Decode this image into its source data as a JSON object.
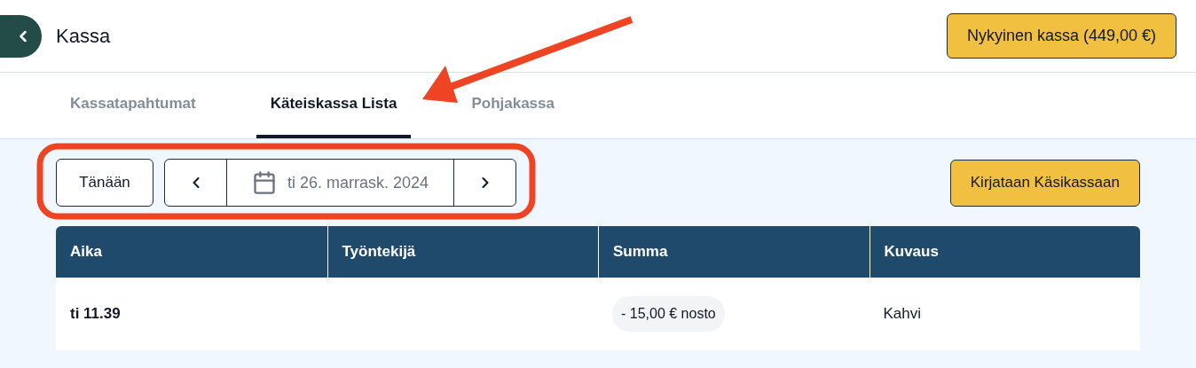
{
  "header": {
    "title": "Kassa",
    "cash_button": "Nykyinen kassa (449,00 €)"
  },
  "tabs": [
    {
      "label": "Kassatapahtumat",
      "selected": false
    },
    {
      "label": "Käteiskassa Lista",
      "selected": true
    },
    {
      "label": "Pohjakassa",
      "selected": false
    }
  ],
  "toolbar": {
    "today_button": "Tänään",
    "date": "ti 26. marrask. 2024",
    "add_button": "Kirjataan Käsikassaan"
  },
  "table": {
    "columns": [
      "Aika",
      "Työntekijä",
      "Summa",
      "Kuvaus"
    ],
    "rows": [
      {
        "time": "ti 11.39",
        "employee": null,
        "amount": "- 15,00 € nosto",
        "description": "Kahvi"
      }
    ]
  }
}
